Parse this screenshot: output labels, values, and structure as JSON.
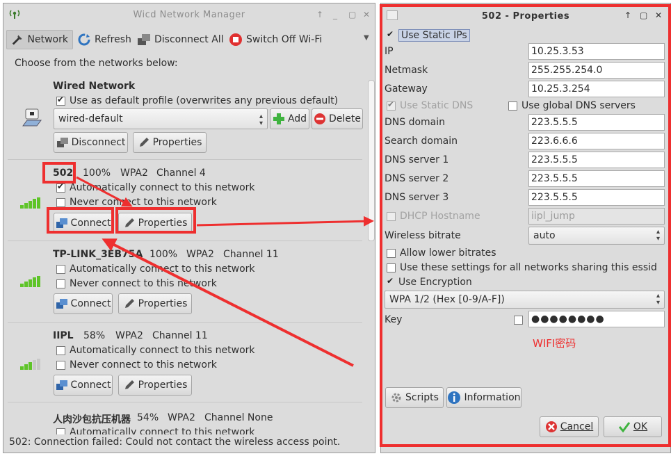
{
  "wicd": {
    "title": "Wicd Network Manager",
    "toolbar": {
      "network": "Network",
      "refresh": "Refresh",
      "disconnect_all": "Disconnect All",
      "switch_off_wifi": "Switch Off Wi-Fi"
    },
    "choose_label": "Choose from the networks below:",
    "wired": {
      "name": "Wired Network",
      "default_profile": "Use as default profile (overwrites any previous default)",
      "profile": "wired-default",
      "add": "Add",
      "delete": "Delete",
      "disconnect": "Disconnect",
      "properties": "Properties"
    },
    "networks": [
      {
        "name": "502",
        "strength": "100%",
        "encryption": "WPA2",
        "channel": "Channel 4",
        "auto": "Automatically connect to this network",
        "never": "Never connect to this network",
        "connect": "Connect",
        "properties": "Properties",
        "bars": 5
      },
      {
        "name": "TP-LINK_3EB75A",
        "strength": "100%",
        "encryption": "WPA2",
        "channel": "Channel 11",
        "auto": "Automatically connect to this network",
        "never": "Never connect to this network",
        "connect": "Connect",
        "properties": "Properties",
        "bars": 5
      },
      {
        "name": "IIPL",
        "strength": "58%",
        "encryption": "WPA2",
        "channel": "Channel 11",
        "auto": "Automatically connect to this network",
        "never": "Never connect to this network",
        "connect": "Connect",
        "properties": "Properties",
        "bars": 3
      },
      {
        "name": "人肉沙包抗压机器",
        "strength": "54%",
        "encryption": "WPA2",
        "channel": "Channel None",
        "auto": "Automatically connect to this network"
      }
    ],
    "status": "502: Connection failed: Could not contact the wireless access point."
  },
  "props": {
    "title": "502 - Properties",
    "use_static_ips": "Use Static IPs",
    "ip_label": "IP",
    "ip": "10.25.3.53",
    "netmask_label": "Netmask",
    "netmask": "255.255.254.0",
    "gateway_label": "Gateway",
    "gateway": "10.25.3.254",
    "use_static_dns": "Use Static DNS",
    "use_global_dns": "Use global DNS servers",
    "dns_domain_label": "DNS domain",
    "dns_domain": "223.5.5.5",
    "search_domain_label": "Search domain",
    "search_domain": "223.6.6.6",
    "dns1_label": "DNS server 1",
    "dns1": "223.5.5.5",
    "dns2_label": "DNS server 2",
    "dns2": "223.5.5.5",
    "dns3_label": "DNS server 3",
    "dns3": "223.5.5.5",
    "dhcp_label": "DHCP Hostname",
    "dhcp": "iipl_jump",
    "bitrate_label": "Wireless bitrate",
    "bitrate": "auto",
    "allow_lower": "Allow lower bitrates",
    "use_settings_all": "Use these settings for all networks sharing this essid",
    "use_encryption": "Use Encryption",
    "encryption_type": "WPA 1/2 (Hex [0-9/A-F])",
    "key_label": "Key",
    "key_value": "●●●●●●●●",
    "scripts": "Scripts",
    "information": "Information",
    "cancel": "Cancel",
    "ok": "OK"
  },
  "annotation": {
    "wifi_note": "WIFI密码",
    "color": "#ee2f2f"
  }
}
